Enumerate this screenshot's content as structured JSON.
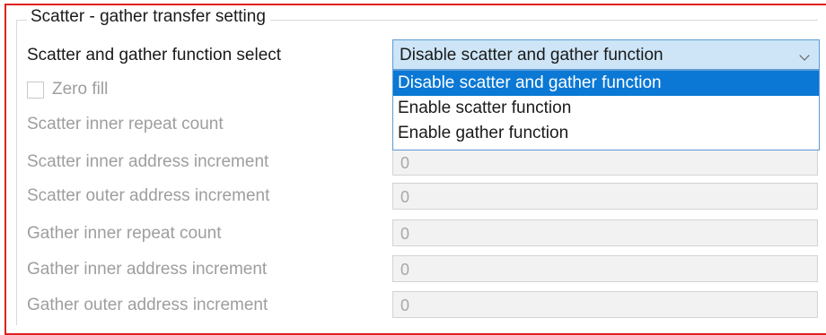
{
  "groupbox": {
    "title": "Scatter - gather transfer setting"
  },
  "function_select": {
    "label": "Scatter and gather function select",
    "value": "Disable scatter and gather function",
    "options": [
      "Disable scatter and gather function",
      "Enable scatter function",
      "Enable gather function"
    ],
    "highlighted_option_index": 0
  },
  "zero_fill": {
    "label": "Zero fill",
    "checked": false
  },
  "rows": [
    {
      "label": "Scatter inner repeat count",
      "value": ""
    },
    {
      "label": "Scatter inner address increment",
      "value": "0"
    },
    {
      "label": "Scatter outer address increment",
      "value": "0"
    },
    {
      "label": "Gather inner repeat count",
      "value": "0"
    },
    {
      "label": "Gather inner address increment",
      "value": "0"
    },
    {
      "label": "Gather outer address increment",
      "value": "0"
    }
  ],
  "colors": {
    "highlight_border": "#e02020",
    "selection": "#0a78d4",
    "select_background": "#cde5f7",
    "disabled_text": "#9e9e9e"
  },
  "icons": {
    "select_arrow": "chevron-down-icon"
  }
}
